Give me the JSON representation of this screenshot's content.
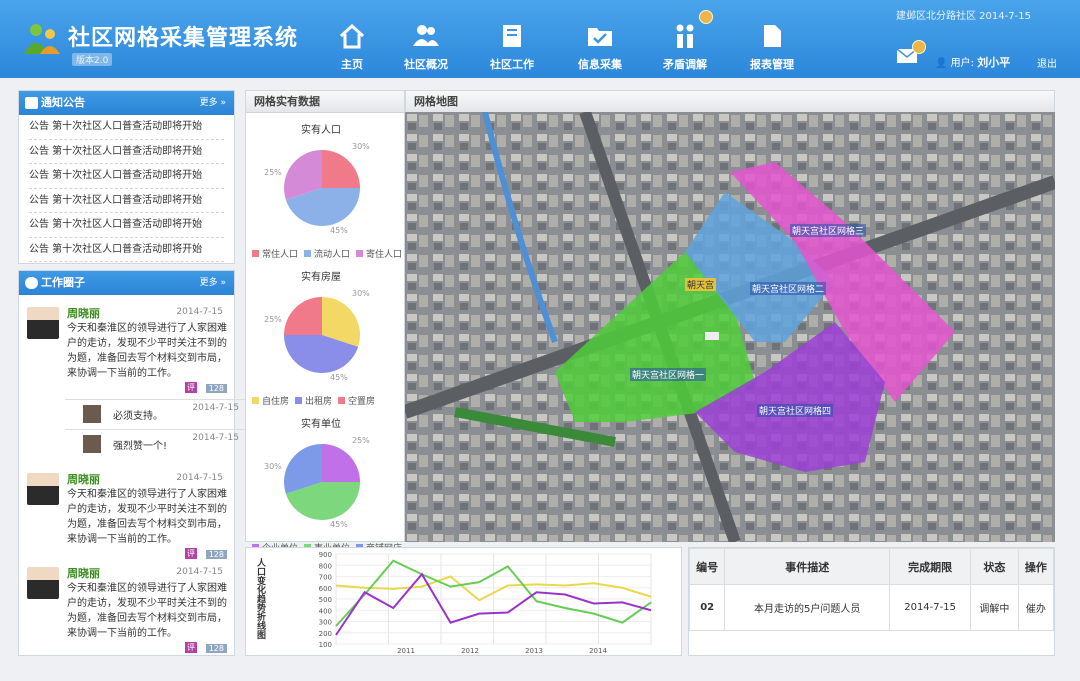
{
  "app": {
    "title": "社区网格采集管理系统",
    "version": "版本2.0",
    "location_date": "建邺区北分路社区  2014-7-15",
    "user_prefix": "用户:",
    "user": "刘小平",
    "logout": "退出"
  },
  "nav": [
    "主页",
    "社区概况",
    "社区工作",
    "信息采集",
    "矛盾调解",
    "报表管理"
  ],
  "notice": {
    "title": "通知公告",
    "more": "更多 »",
    "items": [
      "公告 第十次社区人口普查活动即将开始",
      "公告 第十次社区人口普查活动即将开始",
      "公告 第十次社区人口普查活动即将开始",
      "公告 第十次社区人口普查活动即将开始",
      "公告 第十次社区人口普查活动即将开始",
      "公告 第十次社区人口普查活动即将开始"
    ]
  },
  "circle": {
    "title": "工作圈子",
    "more": "更多 »",
    "posts": [
      {
        "name": "周晓丽",
        "date": "2014-7-15",
        "text": "今天和秦淮区的领导进行了人家困难户的走访，发现不少平时关注不到的为题，准备回去写个材料交到市局，来协调一下当前的工作。",
        "reply_tag": "评",
        "count": "128"
      },
      {
        "name": "周晓丽",
        "date": "2014-7-15",
        "text": "今天和秦淮区的领导进行了人家困难户的走访，发现不少平时关注不到的为题，准备回去写个材料交到市局，来协调一下当前的工作。",
        "reply_tag": "评",
        "count": "128"
      },
      {
        "name": "周晓丽",
        "date": "2014-7-15",
        "text": "今天和秦淮区的领导进行了人家困难户的走访，发现不少平时关注不到的为题，准备回去写个材料交到市局，来协调一下当前的工作。",
        "reply_tag": "评",
        "count": "128"
      }
    ],
    "replies": [
      {
        "text": "必须支持。",
        "date": "2014-7-15"
      },
      {
        "text": "强烈赞一个!",
        "date": "2014-7-15"
      }
    ]
  },
  "stats": {
    "title": "网格实有数据",
    "pies": [
      {
        "title": "实有人口",
        "values": [
          25,
          45,
          30
        ],
        "labels": [
          "常住人口",
          "流动人口",
          "寄住人口"
        ],
        "colors": [
          "#f07a8a",
          "#8cb0e8",
          "#d58ad8"
        ],
        "pct": [
          "30%",
          "25%",
          "45%"
        ]
      },
      {
        "title": "实有房屋",
        "values": [
          30,
          45,
          25
        ],
        "labels": [
          "自住房",
          "出租房",
          "空置房"
        ],
        "colors": [
          "#f3d866",
          "#8a8ee8",
          "#f07a8a"
        ],
        "pct": [
          "30%",
          "25%",
          "45%"
        ]
      },
      {
        "title": "实有单位",
        "values": [
          25,
          45,
          30
        ],
        "labels": [
          "企业单位",
          "事业单位",
          "商铺网店"
        ],
        "colors": [
          "#c070e8",
          "#7dd87d",
          "#7c9ae8"
        ],
        "pct": [
          "25%",
          "30%",
          "45%"
        ]
      }
    ]
  },
  "map": {
    "title": "网格地图",
    "zones": [
      "朝天宫社区网格一",
      "朝天宫社区网格二",
      "朝天宫社区网格三",
      "朝天宫社区网格四"
    ],
    "marker": "朝天宫"
  },
  "chart_data": {
    "type": "line",
    "ylabel": "人口变化趋势折线图",
    "x": [
      "2011",
      "2012",
      "2013",
      "2014"
    ],
    "ylim": [
      100,
      900
    ],
    "yticks": [
      100,
      200,
      300,
      400,
      500,
      600,
      700,
      800,
      900
    ],
    "series": [
      {
        "color": "#e8d84a",
        "values": [
          620,
          600,
          590,
          610,
          700,
          490,
          620,
          630,
          620,
          640,
          600,
          520
        ]
      },
      {
        "color": "#66cc55",
        "values": [
          260,
          540,
          840,
          720,
          610,
          650,
          790,
          480,
          420,
          370,
          290,
          470
        ]
      },
      {
        "color": "#9933cc",
        "values": [
          180,
          560,
          420,
          720,
          290,
          370,
          380,
          560,
          540,
          460,
          470,
          400
        ]
      }
    ]
  },
  "events": {
    "headers": [
      "编号",
      "事件描述",
      "完成期限",
      "状态",
      "操作"
    ],
    "rows": [
      [
        "02",
        "本月走访的5户问题人员",
        "2014-7-15",
        "调解中",
        "催办"
      ]
    ]
  }
}
